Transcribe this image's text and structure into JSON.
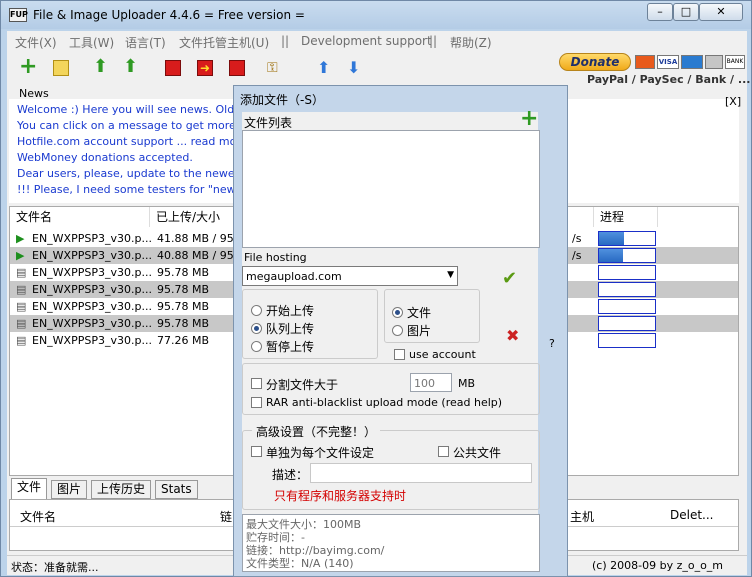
{
  "window": {
    "app_icon_text": "FUP",
    "title": "File & Image Uploader 4.4.6  = Free version ="
  },
  "menu": [
    "文件(X)",
    "工具(W)",
    "语言(T)",
    "文件托管主机(U)",
    "||",
    "Development support",
    "||",
    "帮助(Z)"
  ],
  "donate": {
    "button": "Donate",
    "cards": [
      "VISA",
      "BANK"
    ],
    "subtext": "PayPal / PaySec / Bank / ..."
  },
  "news": {
    "label": "News",
    "close": "[X]",
    "lines": [
      "Welcome :) Here you will see news. Old mess",
      "You can click on a message to get more info.",
      "Hotfile.com account support ... read more.",
      "WebMoney donations accepted.",
      "Dear users, please, update to the newest ver",
      "!!! Please, I need some testers for \"new File U"
    ]
  },
  "grid": {
    "col_name": "文件名",
    "col_uploaded": "已上传/大小",
    "col_progress": "进程",
    "rows": [
      {
        "name": "EN_WXPPSP3_v30.p...",
        "size": "41.88 MB / 95...",
        "speed": "/s",
        "progress": 0.45
      },
      {
        "name": "EN_WXPPSP3_v30.p...",
        "size": "40.88 MB / 95...",
        "speed": "/s",
        "progress": 0.43
      },
      {
        "name": "EN_WXPPSP3_v30.p...",
        "size": "95.78 MB",
        "speed": "",
        "progress": 0
      },
      {
        "name": "EN_WXPPSP3_v30.p...",
        "size": "95.78 MB",
        "speed": "",
        "progress": 0
      },
      {
        "name": "EN_WXPPSP3_v30.p...",
        "size": "95.78 MB",
        "speed": "",
        "progress": 0
      },
      {
        "name": "EN_WXPPSP3_v30.p...",
        "size": "95.78 MB",
        "speed": "",
        "progress": 0
      },
      {
        "name": "EN_WXPPSP3_v30.p...",
        "size": "77.26 MB",
        "speed": "",
        "progress": 0
      }
    ]
  },
  "bottom_tabs": [
    "文件",
    "图片",
    "上传历史",
    "Stats"
  ],
  "lower_table": {
    "col_name": "文件名",
    "col_link": "链",
    "col_host": "主机",
    "col_delete": "Delet..."
  },
  "status": {
    "left": "状态：准备就需...",
    "right": "(c) 2008-09 by z_o_o_m"
  },
  "dialog": {
    "title": "添加文件（-S）",
    "file_list_label": "文件列表",
    "hosting_label": "File hosting",
    "hosting_value": "megaupload.com",
    "radio_start": "开始上传",
    "radio_queue": "队列上传",
    "radio_pause": "暂停上传",
    "radio_file": "文件",
    "radio_image": "图片",
    "use_account": "use account",
    "question": "?",
    "split_label": "分割文件大于",
    "split_value": "100",
    "split_unit": "MB",
    "rar_label": "RAR anti-blacklist upload mode (read help)",
    "advanced_title": "高级设置（不完整！）",
    "per_file": "单独为每个文件设定",
    "public_file": "公共文件",
    "desc_label": "描述：",
    "warning": "只有程序和服务器支持时",
    "info_lines": [
      "最大文件大小：100MB",
      "贮存时间：-",
      "链接：http://bayimg.com/",
      "文件类型：N/A (140)"
    ]
  },
  "colors": {
    "accent": "#1a2fc8",
    "warning": "#d40000",
    "news_text": "#1a3ad0"
  }
}
